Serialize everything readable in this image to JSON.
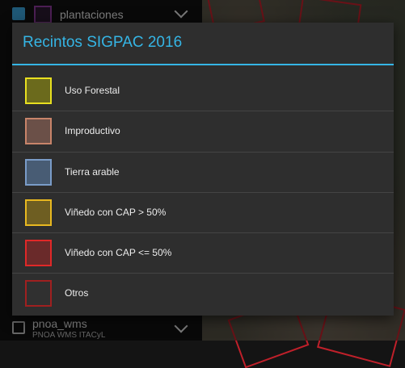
{
  "background": {
    "layers": [
      {
        "name": "plantaciones",
        "checked": true
      },
      {
        "name": "pnoa_wms",
        "subtitle": "PNOA WMS ITACyL",
        "checked": false
      }
    ]
  },
  "dialog": {
    "title": "Recintos SIGPAC 2016",
    "accent_color": "#35b5e5",
    "legend": [
      {
        "label": "Uso Forestal",
        "border": "#e8e020",
        "fill": "#6b6a1c"
      },
      {
        "label": "Improductivo",
        "border": "#c8846a",
        "fill": "#6b5048"
      },
      {
        "label": "Tierra arable",
        "border": "#7a9cc8",
        "fill": "#485c74"
      },
      {
        "label": "Viñedo con CAP > 50%",
        "border": "#e8b820",
        "fill": "#6e5e22"
      },
      {
        "label": "Viñedo con CAP <= 50%",
        "border": "#e02828",
        "fill": "#6a2a2a"
      },
      {
        "label": "Otros",
        "border": "#a02020",
        "fill": "#303030"
      }
    ]
  }
}
